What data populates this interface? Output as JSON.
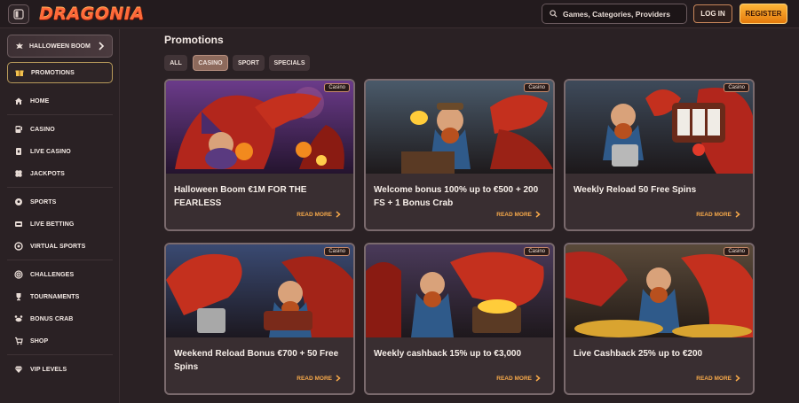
{
  "header": {
    "logo": "DRAGONIA",
    "search_placeholder": "Games, Categories, Providers",
    "login_label": "LOG IN",
    "register_label": "REGISTER"
  },
  "sidebar": {
    "promo_card_label": "HALLOWEEN BOOM",
    "promotions_label": "PROMOTIONS",
    "items": [
      {
        "label": "HOME",
        "icon": "home-icon"
      },
      {
        "label": "CASINO",
        "icon": "slot-machine-icon"
      },
      {
        "label": "LIVE CASINO",
        "icon": "card-icon"
      },
      {
        "label": "JACKPOTS",
        "icon": "clover-icon"
      },
      {
        "label": "SPORTS",
        "icon": "soccer-ball-icon"
      },
      {
        "label": "LIVE BETTING",
        "icon": "live-icon"
      },
      {
        "label": "VIRTUAL SPORTS",
        "icon": "virtual-icon"
      },
      {
        "label": "CHALLENGES",
        "icon": "target-icon"
      },
      {
        "label": "TOURNAMENTS",
        "icon": "trophy-icon"
      },
      {
        "label": "BONUS CRAB",
        "icon": "crab-icon"
      },
      {
        "label": "SHOP",
        "icon": "cart-icon"
      },
      {
        "label": "VIP LEVELS",
        "icon": "diamond-icon"
      }
    ]
  },
  "main": {
    "title": "Promotions",
    "filters": [
      "ALL",
      "CASINO",
      "SPORT",
      "SPECIALS"
    ],
    "active_filter": "CASINO",
    "cards": [
      {
        "tag": "Casino",
        "title": "Halloween Boom €1M FOR THE FEARLESS",
        "cta": "READ MORE"
      },
      {
        "tag": "Casino",
        "title": "Welcome bonus 100% up to €500 + 200 FS + 1 Bonus Crab",
        "cta": "READ MORE"
      },
      {
        "tag": "Casino",
        "title": "Weekly Reload 50 Free Spins",
        "cta": "READ MORE"
      },
      {
        "tag": "Casino",
        "title": "Weekend Reload Bonus €700 + 50 Free Spins",
        "cta": "READ MORE"
      },
      {
        "tag": "Casino",
        "title": "Weekly cashback 15% up to €3,000",
        "cta": "READ MORE"
      },
      {
        "tag": "Casino",
        "title": "Live Cashback 25% up to €200",
        "cta": "READ MORE"
      }
    ]
  },
  "colors": {
    "accent_orange": "#f7a94a",
    "register_gradient_top": "#ffb638",
    "register_gradient_bottom": "#e47a0c",
    "background": "#2a2124"
  }
}
